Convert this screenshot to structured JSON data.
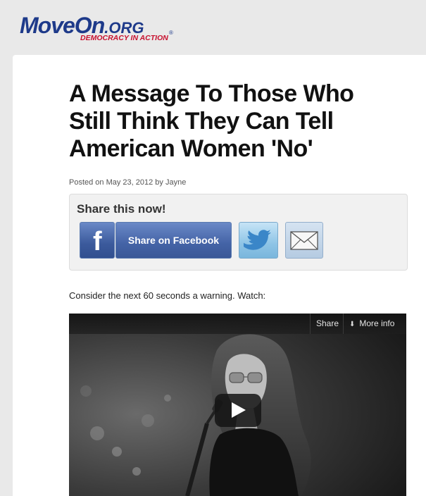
{
  "logo": {
    "main": "MoveOn",
    "org": ".ORG",
    "tagline": "DEMOCRACY IN ACTION",
    "reg": "®"
  },
  "article": {
    "title": "A Message To Those Who Still Think They Can Tell American Women 'No'",
    "posted": "Posted on May 23, 2012 by Jayne",
    "body": "Consider the next 60 seconds a warning. Watch:"
  },
  "share": {
    "heading": "Share this now!",
    "facebook_label": "Share on Facebook",
    "facebook_icon": "facebook-f-icon",
    "twitter_icon": "twitter-bird-icon",
    "email_icon": "envelope-icon"
  },
  "video": {
    "share_label": "Share",
    "more_info_label": "More info",
    "play_icon": "play-icon"
  }
}
